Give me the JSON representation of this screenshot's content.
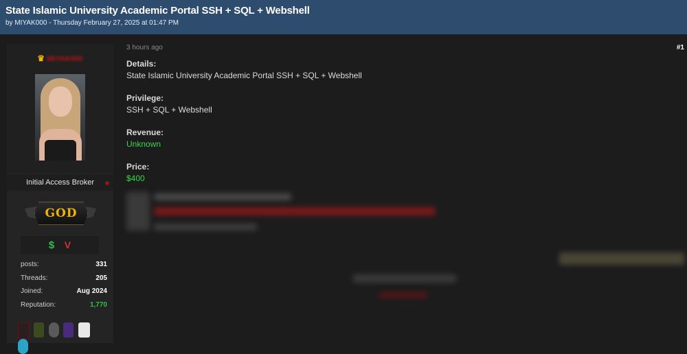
{
  "thread": {
    "title": "State Islamic University Academic Portal SSH + SQL + Webshell",
    "meta": "by MIYAK000 - Thursday February 27, 2025 at 01:47 PM"
  },
  "user": {
    "username": "MIYAK000",
    "role": "Initial Access Broker",
    "rank_badge": "GOD",
    "badges": {
      "dollar": "$",
      "v": "V"
    },
    "stats": [
      {
        "label": "posts:",
        "value": "331"
      },
      {
        "label": "Threads:",
        "value": "205"
      },
      {
        "label": "Joined:",
        "value": "Aug 2024"
      },
      {
        "label": "Reputation:",
        "value": "1,770"
      }
    ]
  },
  "post": {
    "time": "3 hours ago",
    "number": "#1",
    "fields": [
      {
        "label": "Details:",
        "value": "State Islamic University Academic Portal SSH + SQL + Webshell"
      },
      {
        "label": "Privilege:",
        "value": "SSH + SQL + Webshell"
      },
      {
        "label": "Revenue:",
        "value": "Unknown"
      },
      {
        "label": "Price:",
        "value": "$400"
      }
    ]
  },
  "colors": {
    "header_bg": "#2d4c6e",
    "page_bg": "#1c1c1c",
    "green": "#3bd44e",
    "username_red": "#b01414",
    "gold": "#f0b400"
  }
}
